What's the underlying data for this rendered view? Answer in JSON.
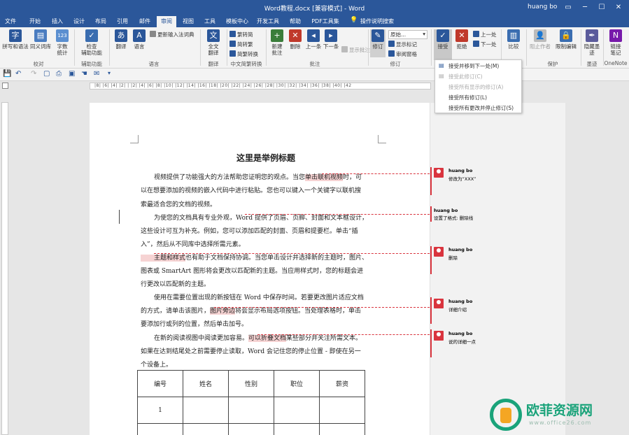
{
  "window": {
    "title": "Word教程.docx [兼容模式]  -  Word",
    "user": "huang bo",
    "controls": [
      "▭",
      "─",
      "☐",
      "✕"
    ]
  },
  "tabs": [
    "文件",
    "开始",
    "插入",
    "设计",
    "布局",
    "引用",
    "邮件",
    "审阅",
    "视图",
    "工具",
    "模板中心",
    "开发工具",
    "帮助",
    "PDF工具集",
    "操作说明搜索"
  ],
  "ribbon": {
    "buttons": {
      "spelling": "拼写和语法",
      "thesaurus": "同义词库",
      "wordcount_1": "字数",
      "wordcount_2": "统计",
      "accessibility_1": "检查",
      "accessibility_2": "辅助功能",
      "translate": "翻译",
      "language": "语言",
      "update_ime": "更新输入法词典",
      "full_translate_1": "全文",
      "full_translate_2": "翻译",
      "trad_to_simp": "繁转简",
      "simp_to_trad": "简转繁",
      "simp_trad_convert": "简繁转换",
      "new_comment_1": "新建",
      "new_comment_2": "批注",
      "delete": "删除",
      "prev": "上一条",
      "next": "下一条",
      "show_comments": "显示批注",
      "track_changes": "修订",
      "markup_simple": "原始...",
      "show_markup": "显示标记",
      "review_pane": "审阅窗格",
      "accept": "接受",
      "reject": "拒绝",
      "prev_change": "上一处",
      "next_change": "下一处",
      "compare": "比较",
      "block_authors": "阻止作者",
      "restrict_editing": "限制编辑",
      "hide_ink_1": "隐藏墨",
      "hide_ink_2": "迹",
      "linked_notes_1": "链接",
      "linked_notes_2": "笔记"
    },
    "groups": {
      "proofing": "校对",
      "accessibility": "辅助功能",
      "language": "语言",
      "translate": "翻译",
      "chinese_convert": "中文简繁转换",
      "comments": "批注",
      "tracking": "修订",
      "protect": "保护",
      "ink": "墨迹",
      "onenote": "OneNote"
    }
  },
  "accept_menu": {
    "items": [
      {
        "label": "接受并移到下一处(M)",
        "enabled": true
      },
      {
        "label": "接受此修订(C)",
        "enabled": false
      },
      {
        "label": "接受所有显示的修订(A)",
        "enabled": false
      },
      {
        "label": "接受所有修订(L)",
        "enabled": true
      },
      {
        "label": "接受所有更改并停止修订(S)",
        "enabled": true
      }
    ]
  },
  "ruler": {
    "numbers": "|8| |6| |4| |2| | |2| |4| |6| |8| |10| |12| |14| |16| |18| |20| |22| |24| |26| |28| |30| |32| |34| |36| |38| |40| |42"
  },
  "document": {
    "title": "这里是举例标题",
    "lines": [
      [
        "视频提供了功能强大的方法帮助您证明您的观点。当您",
        "单击联机视频",
        "时，可"
      ],
      [
        "以在想要添加的视频的嵌入代码中进行粘贴。您也可以键入一个关键字以联机搜"
      ],
      [
        "索最适合您的文档的视频。"
      ],
      [
        "为使您的文档具有专业外观，Word 提供了页眉、页脚、封面和文本框设计，"
      ],
      [
        "这些设计可互为补充。例如，您可以添加匹配的封面、页眉和提要栏。单击“插"
      ],
      [
        "入”，然后从不同库中选择所需元素。"
      ],
      [
        "",
        "主题和样式",
        "也有助于文档保持协调。当您单击设计并选择新的主题时，图片、"
      ],
      [
        "图表或 SmartArt 图形将会更改以匹配新的主题。当应用样式时，您的标题会进"
      ],
      [
        "行更改以匹配新的主题。"
      ],
      [
        "使用在需要位置出现的新按钮在 Word 中保存时间。若要更改图片适应文档"
      ],
      [
        "的方式，请单击该图片，",
        "图片旁边",
        "将会显示布局选项按钮。当处理表格时，单击"
      ],
      [
        "要添加行或列的位置，然后单击加号。"
      ],
      [
        "在新的阅读视图中阅读更加容易。",
        "可以折叠文档",
        "某些部分并关注所需文本。"
      ],
      [
        "如果在达到结尾处之前需要停止读取，Word 会记住您的停止位置 - 即使在另一"
      ],
      [
        "个设备上。"
      ]
    ],
    "table": {
      "headers": [
        "编号",
        "姓名",
        "性别",
        "职位",
        "薪资"
      ],
      "rows": [
        [
          "1",
          "",
          "",
          "",
          ""
        ],
        [
          "",
          "",
          "",
          "",
          ""
        ]
      ]
    }
  },
  "comments": [
    {
      "author": "huang bo",
      "text": "修改为“XXX”"
    },
    {
      "author": "huang bo",
      "text": "设置了格式: 删除线"
    },
    {
      "author": "huang bo",
      "text": "删除"
    },
    {
      "author": "huang bo",
      "text": "详细介绍"
    },
    {
      "author": "huang bo",
      "text": "说的详细一点"
    }
  ],
  "watermark": {
    "brand": "欧菲资源网",
    "url": "www.office26.com"
  },
  "colors": {
    "brand_blue": "#2b579a",
    "change_red": "#d9343e",
    "highlight": "#f6d3d3",
    "watermark_green": "#1aa37a"
  }
}
